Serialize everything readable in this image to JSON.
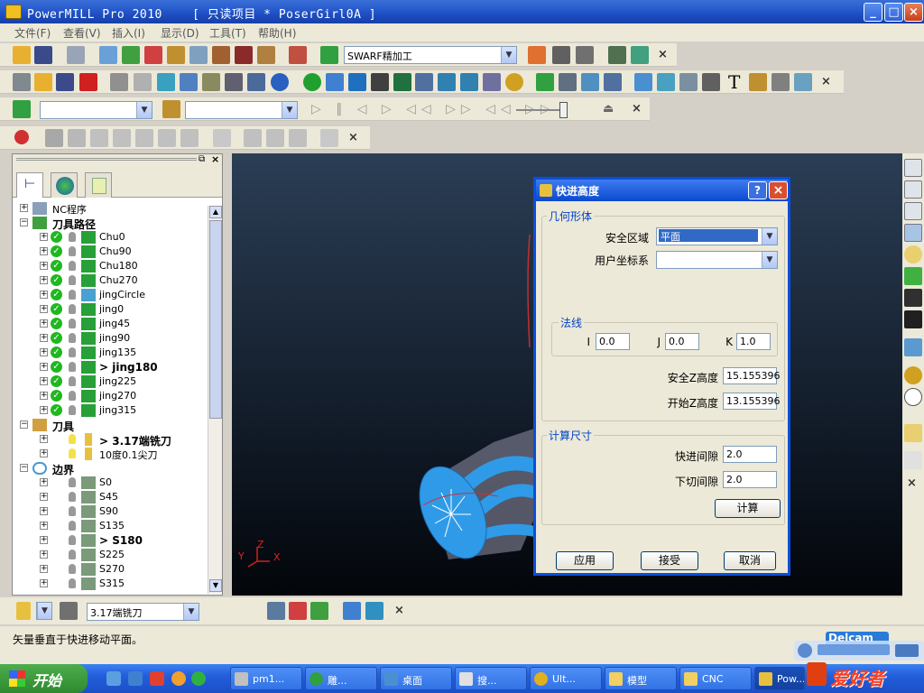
{
  "window": {
    "title": "PowerMILL Pro 2010    [ 只读项目 * PoserGirl0A ]",
    "buttons": {
      "minimize": "_",
      "maximize": "□",
      "close": "×"
    }
  },
  "menu": [
    "文件(F)",
    "查看(V)",
    "插入(I)",
    "显示(D)",
    "工具(T)",
    "帮助(H)"
  ],
  "toolbar1": {
    "strategy_select": "SWARF精加工"
  },
  "toolbar4": {
    "close": "×"
  },
  "explorer": {
    "tree": [
      {
        "label": "NC程序",
        "bold": false,
        "level": 0,
        "type": "nc"
      },
      {
        "label": "刀具路径",
        "bold": true,
        "level": 0,
        "type": "folder-tp"
      },
      {
        "label": "Chu0",
        "bold": false,
        "level": 1,
        "type": "tp"
      },
      {
        "label": "Chu90",
        "bold": false,
        "level": 1,
        "type": "tp"
      },
      {
        "label": "Chu180",
        "bold": false,
        "level": 1,
        "type": "tp"
      },
      {
        "label": "Chu270",
        "bold": false,
        "level": 1,
        "type": "tp"
      },
      {
        "label": "jingCircle",
        "bold": false,
        "level": 1,
        "type": "tp-circle"
      },
      {
        "label": "jing0",
        "bold": false,
        "level": 1,
        "type": "tp"
      },
      {
        "label": "jing45",
        "bold": false,
        "level": 1,
        "type": "tp"
      },
      {
        "label": "jing90",
        "bold": false,
        "level": 1,
        "type": "tp"
      },
      {
        "label": "jing135",
        "bold": false,
        "level": 1,
        "type": "tp"
      },
      {
        "label": "> jing180",
        "bold": true,
        "level": 1,
        "type": "tp"
      },
      {
        "label": "jing225",
        "bold": false,
        "level": 1,
        "type": "tp"
      },
      {
        "label": "jing270",
        "bold": false,
        "level": 1,
        "type": "tp"
      },
      {
        "label": "jing315",
        "bold": false,
        "level": 1,
        "type": "tp"
      },
      {
        "label": "刀具",
        "bold": true,
        "level": 0,
        "type": "folder-tool"
      },
      {
        "label": "> 3.17端铣刀",
        "bold": true,
        "level": 1,
        "type": "tool"
      },
      {
        "label": "10度0.1尖刀",
        "bold": false,
        "level": 1,
        "type": "tool"
      },
      {
        "label": "边界",
        "bold": true,
        "level": 0,
        "type": "folder-bd"
      },
      {
        "label": "S0",
        "bold": false,
        "level": 1,
        "type": "bd"
      },
      {
        "label": "S45",
        "bold": false,
        "level": 1,
        "type": "bd"
      },
      {
        "label": "S90",
        "bold": false,
        "level": 1,
        "type": "bd"
      },
      {
        "label": "S135",
        "bold": false,
        "level": 1,
        "type": "bd"
      },
      {
        "label": "> S180",
        "bold": true,
        "level": 1,
        "type": "bd"
      },
      {
        "label": "S225",
        "bold": false,
        "level": 1,
        "type": "bd"
      },
      {
        "label": "S270",
        "bold": false,
        "level": 1,
        "type": "bd"
      },
      {
        "label": "S315",
        "bold": false,
        "level": 1,
        "type": "bd"
      }
    ]
  },
  "dialog": {
    "title": "快进高度",
    "help": "?",
    "close": "×",
    "geometry_group": "几何形体",
    "safe_area_label": "安全区域",
    "safe_area_value": "平面",
    "ucs_label": "用户坐标系",
    "ucs_value": "",
    "normal_group": "法线",
    "i_label": "I",
    "i_value": "0.0",
    "j_label": "J",
    "j_value": "0.0",
    "k_label": "K",
    "k_value": "1.0",
    "safe_z_label": "安全Z高度",
    "safe_z_value": "15.155396",
    "start_z_label": "开始Z高度",
    "start_z_value": "13.155396",
    "calc_group": "计算尺寸",
    "rapid_gap_label": "快进间隙",
    "rapid_gap_value": "2.0",
    "plunge_gap_label": "下切间隙",
    "plunge_gap_value": "2.0",
    "calc_button": "计算",
    "apply_button": "应用",
    "accept_button": "接受",
    "cancel_button": "取消"
  },
  "viewport": {
    "axis_y": "Y",
    "axis_z": "Z",
    "axis_x": "X"
  },
  "bottombar": {
    "tool_select": "3.17端铣刀"
  },
  "status": {
    "message": "矢量垂直于快进移动平面。"
  },
  "taskbar": {
    "start": "开始",
    "tasks": [
      "pm1...",
      "雕...",
      "桌面",
      "搜...",
      "Ult...",
      "模型",
      "CNC",
      "Pow..."
    ],
    "watermark": "爱好者",
    "tray_text": "Delcam"
  },
  "colors": {
    "titlebar": "#1e4fc4",
    "dialog_border": "#0a4fdb",
    "group_label": "#0042c8",
    "check_green": "#1fb81f",
    "part_blue": "#2f9be8"
  }
}
